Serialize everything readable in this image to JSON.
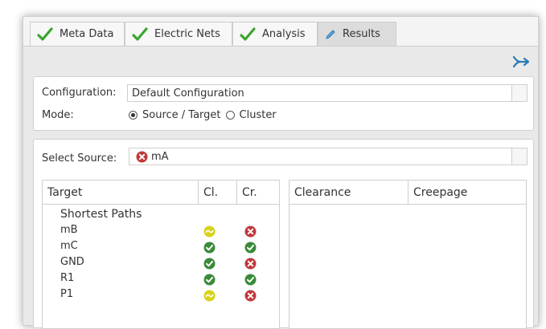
{
  "tabs": [
    {
      "label": "Meta Data",
      "icon": "check-icon",
      "active": false
    },
    {
      "label": "Electric Nets",
      "icon": "check-icon",
      "active": false
    },
    {
      "label": "Analysis",
      "icon": "check-icon",
      "active": false
    },
    {
      "label": "Results",
      "icon": "pencil-icon",
      "active": true
    }
  ],
  "config": {
    "configuration_label": "Configuration:",
    "configuration_value": "Default Configuration",
    "mode_label": "Mode:",
    "mode_options": [
      {
        "label": "Source / Target",
        "selected": true
      },
      {
        "label": "Cluster",
        "selected": false
      }
    ]
  },
  "source": {
    "label": "Select Source:",
    "value": "mA",
    "value_icon": "error-icon"
  },
  "target_table": {
    "columns": [
      "Target",
      "Cl.",
      "Cr."
    ],
    "group": "Shortest Paths",
    "rows": [
      {
        "name": "mB",
        "cl": "warning",
        "cr": "error"
      },
      {
        "name": "mC",
        "cl": "ok",
        "cr": "ok"
      },
      {
        "name": "GND",
        "cl": "ok",
        "cr": "error"
      },
      {
        "name": "R1",
        "cl": "ok",
        "cr": "ok"
      },
      {
        "name": "P1",
        "cl": "warning",
        "cr": "error"
      }
    ]
  },
  "results_table": {
    "columns": [
      "Clearance",
      "Creepage"
    ]
  },
  "colors": {
    "ok": "#3a8a3a",
    "error": "#c0393b",
    "warning": "#d9d21a",
    "check": "#3aa52e",
    "accent": "#2a7ab8"
  }
}
